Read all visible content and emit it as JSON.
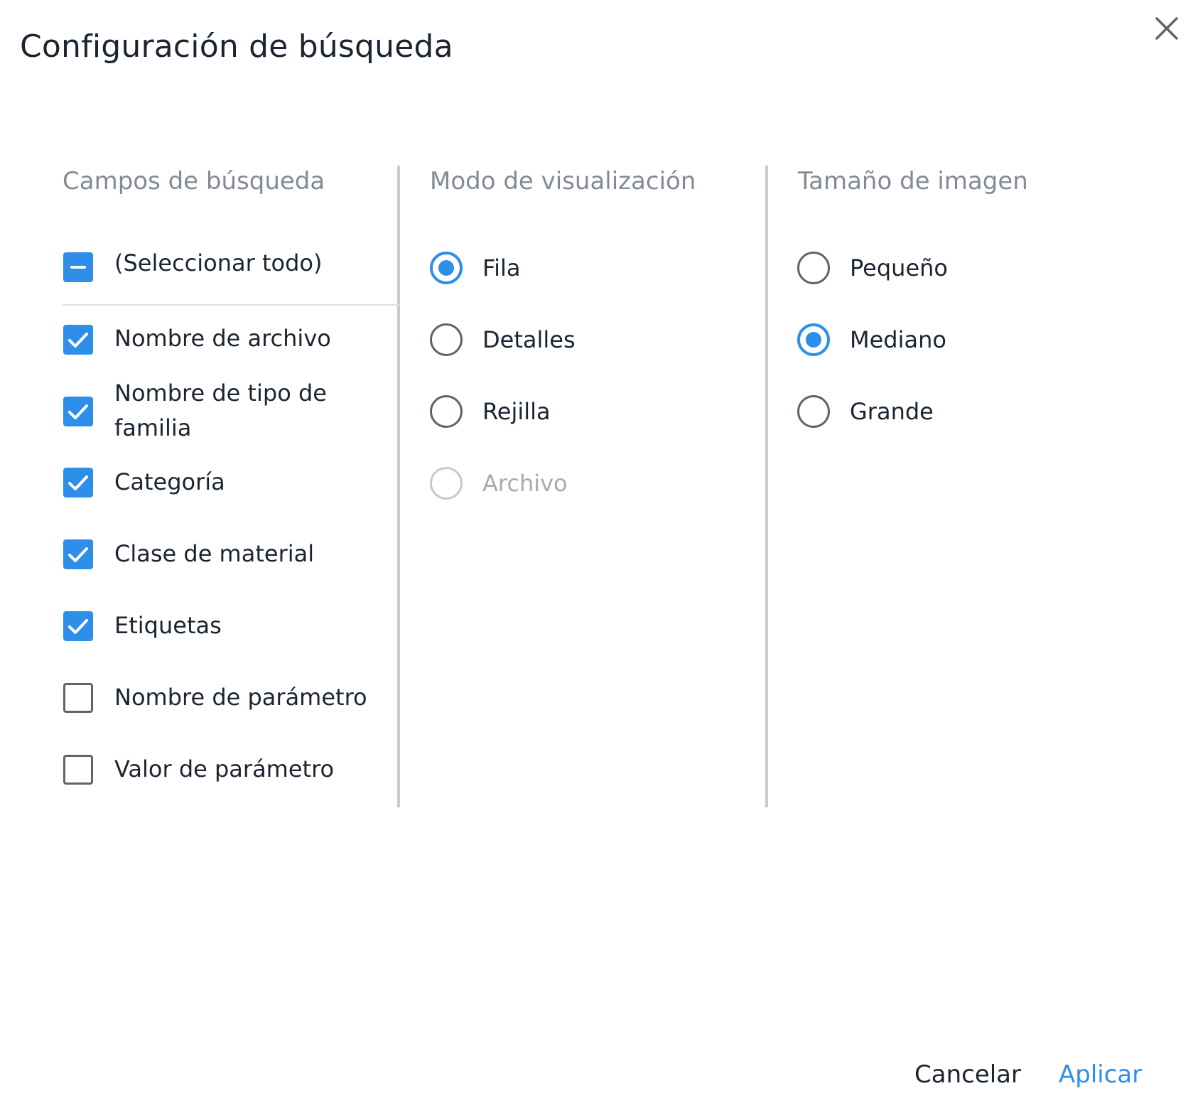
{
  "dialog": {
    "title": "Configuración de búsqueda",
    "close_icon": "close-icon"
  },
  "search_fields": {
    "title": "Campos de búsqueda",
    "select_all": {
      "label": "(Seleccionar todo)",
      "state": "indeterminate"
    },
    "items": [
      {
        "label": "Nombre de archivo",
        "checked": true
      },
      {
        "label_line1": "Nombre de tipo de",
        "label_line2": "familia",
        "checked": true
      },
      {
        "label": "Categoría",
        "checked": true
      },
      {
        "label": "Clase de material",
        "checked": true
      },
      {
        "label": "Etiquetas",
        "checked": true
      },
      {
        "label": "Nombre de parámetro",
        "checked": false
      },
      {
        "label": "Valor de parámetro",
        "checked": false
      }
    ]
  },
  "view_mode": {
    "title": "Modo de visualización",
    "options": [
      {
        "label": "Fila",
        "selected": true,
        "disabled": false
      },
      {
        "label": "Detalles",
        "selected": false,
        "disabled": false
      },
      {
        "label": "Rejilla",
        "selected": false,
        "disabled": false
      },
      {
        "label": "Archivo",
        "selected": false,
        "disabled": true
      }
    ]
  },
  "image_size": {
    "title": "Tamaño de imagen",
    "options": [
      {
        "label": "Pequeño",
        "selected": false
      },
      {
        "label": "Mediano",
        "selected": true
      },
      {
        "label": "Grande",
        "selected": false
      }
    ]
  },
  "footer": {
    "cancel_label": "Cancelar",
    "apply_label": "Aplicar"
  },
  "colors": {
    "accent": "#2d8fea",
    "text": "#1b2431",
    "muted": "#838a95"
  }
}
